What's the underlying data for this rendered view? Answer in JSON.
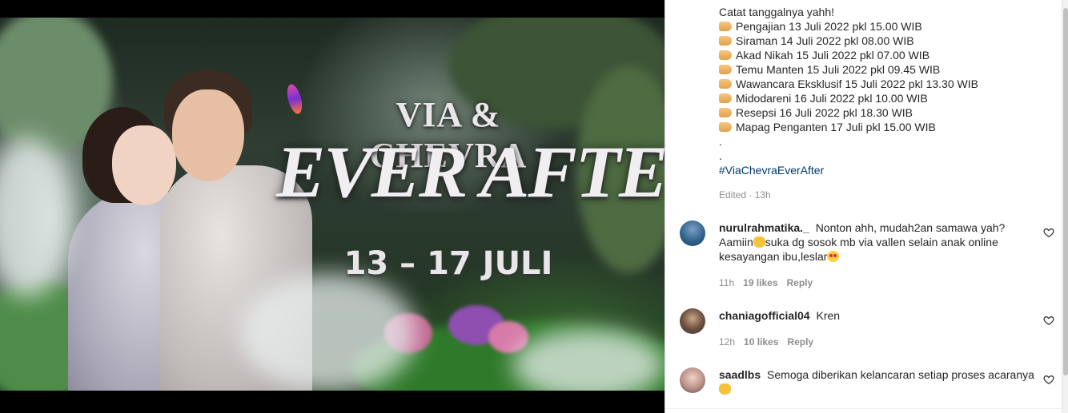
{
  "poster": {
    "title_top": "VIA & CHEVRA",
    "title_main": "EVER AFTER",
    "dates": "13 – 17 JULI"
  },
  "caption": {
    "intro": "Catat tanggalnya yahh!",
    "events": [
      "Pengajian 13 Juli 2022 pkl 15.00 WIB",
      "Siraman 14 Juli 2022 pkl 08.00 WIB",
      "Akad Nikah 15 Juli 2022 pkl 07.00 WIB",
      "Temu Manten 15 Juli 2022 pkl 09.45 WIB",
      "Wawancara Eksklusif 15 Juli 2022 pkl 13.30 WIB",
      "Midodareni 16 Juli 2022 pkl 10.00 WIB",
      "Resepsi 16 Juli 2022 pkl 18.30 WIB",
      "Mapag Penganten 17 Juli pkl 15.00 WIB"
    ],
    "dot1": ".",
    "dot2": ".",
    "hashtag": "#ViaChevraEverAfter",
    "edited": "Edited · 13h"
  },
  "comments": [
    {
      "username": "nurulrahmatika._",
      "text_a": "Nonton ahh, mudah2an samawa yah? Aamiin",
      "text_b": "suka dg sosok mb via vallen selain anak online kesayangan ibu,leslar",
      "time": "11h",
      "likes": "19 likes",
      "reply": "Reply"
    },
    {
      "username": "chaniagofficial04",
      "text": "Kren",
      "time": "12h",
      "likes": "10 likes",
      "reply": "Reply"
    },
    {
      "username": "saadlbs",
      "text": "Semoga diberikan kelancaran setiap proses acaranya",
      "time": "",
      "likes": "",
      "reply": ""
    }
  ],
  "icons": {
    "like": "heart-outline-icon",
    "pointer": "backhand-index-pointing-right-icon",
    "hands": "palms-up-together-icon",
    "love": "smiling-face-with-heart-eyes-icon"
  },
  "colors": {
    "hashtag": "#00376b",
    "text": "#262626",
    "muted": "#8e8e8e"
  }
}
